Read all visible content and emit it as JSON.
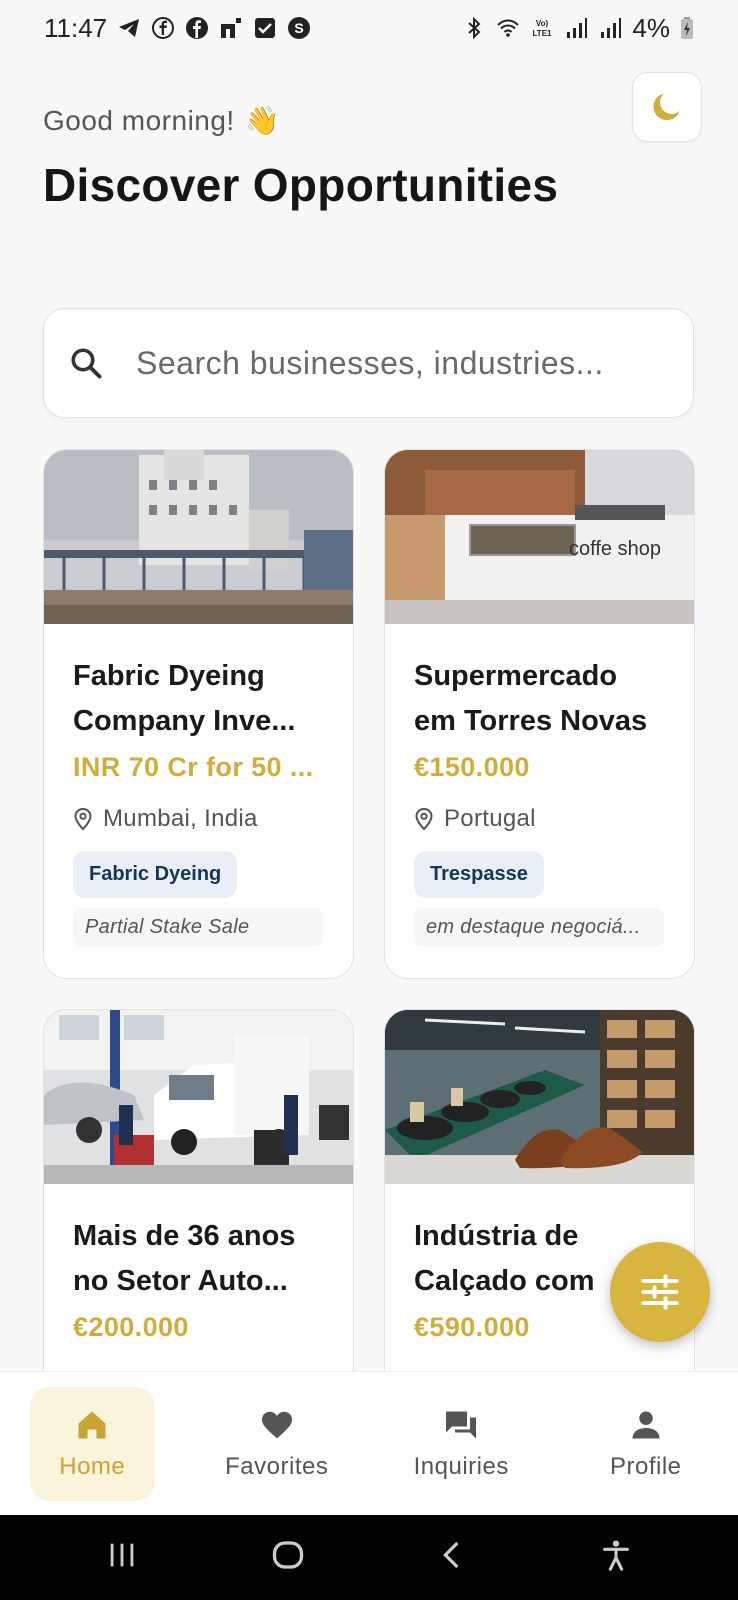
{
  "status_bar": {
    "time": "11:47",
    "battery": "4%"
  },
  "header": {
    "greeting": "Good morning!",
    "greeting_emoji": "👋",
    "title": "Discover Opportunities"
  },
  "search": {
    "placeholder": "Search businesses, industries..."
  },
  "listings": [
    {
      "title": "Fabric Dyeing Company Inve...",
      "price": "INR 70 Cr for 50 ...",
      "location": "Mumbai, India",
      "tag": "Fabric Dyeing",
      "subtag": "Partial Stake Sale",
      "image": "factory-photo"
    },
    {
      "title": "Supermercado em Torres Novas",
      "price": "€150.000",
      "location": "Portugal",
      "tag": "Trespasse",
      "subtag": "em destaque negociá...",
      "image": "coffee-shop-photo",
      "image_sign": "coffe shop"
    },
    {
      "title": "Mais de 36 anos no Setor Auto...",
      "price": "€200.000",
      "image": "auto-garage-photo"
    },
    {
      "title": "Indústria de Calçado com",
      "price": "€590.000",
      "image": "shoe-factory-photo"
    }
  ],
  "bottom_nav": [
    {
      "label": "Home",
      "icon": "home-icon",
      "active": true
    },
    {
      "label": "Favorites",
      "icon": "heart-icon",
      "active": false
    },
    {
      "label": "Inquiries",
      "icon": "chat-icon",
      "active": false
    },
    {
      "label": "Profile",
      "icon": "person-icon",
      "active": false
    }
  ],
  "colors": {
    "accent": "#d3ad3c",
    "tag_bg": "#e9eff6",
    "tag_text": "#17345a"
  }
}
